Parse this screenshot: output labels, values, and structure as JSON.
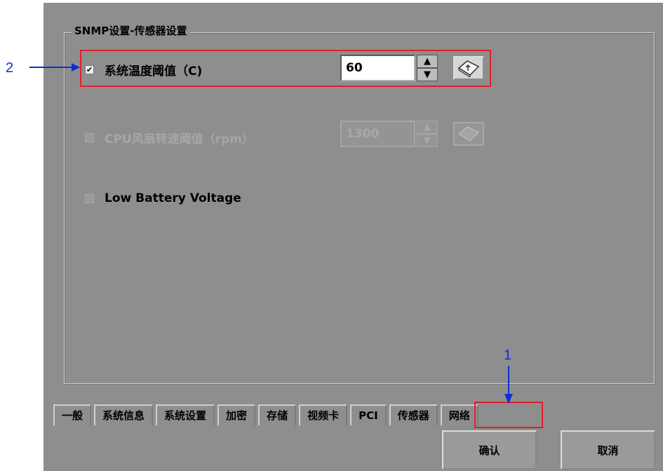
{
  "group": {
    "title": "SNMP设置-传感器设置"
  },
  "rows": [
    {
      "label": "系统温度阈值（C)",
      "checked": true,
      "enabled": true,
      "value": "60"
    },
    {
      "label": "CPU风扇转速阈值（rpm）",
      "checked": false,
      "enabled": false,
      "value": "1300"
    },
    {
      "label": "Low Battery Voltage",
      "checked": false,
      "enabled": true
    }
  ],
  "tabs": [
    "一般",
    "系统信息",
    "系统设置",
    "加密",
    "存储",
    "视频卡",
    "PCI",
    "传感器",
    "网络"
  ],
  "active_tab": "传感器",
  "buttons": {
    "confirm": "确认",
    "cancel": "取消"
  },
  "annotations": {
    "marker1": "1",
    "marker2": "2"
  },
  "colors": {
    "annotation_box": "#e0202a",
    "annotation_arrow": "#0a2fd6",
    "dialog_bg": "#8e8e8e"
  },
  "icons": {
    "checkmark": "✔",
    "spin_up": "▲",
    "spin_down": "▼",
    "keyboard": "keyboard-icon"
  }
}
